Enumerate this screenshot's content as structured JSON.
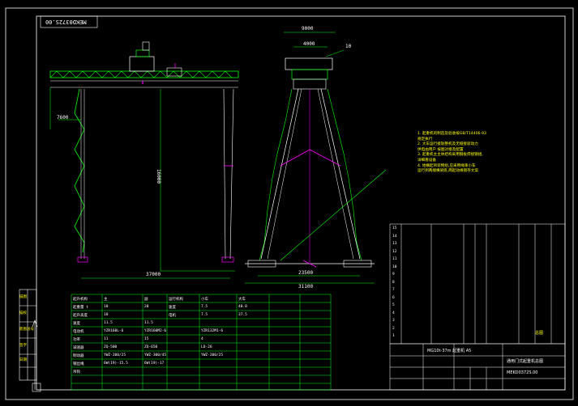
{
  "drawing": {
    "stamp_text": "MEKD0372S.00",
    "dimensions": {
      "top_width": "9000",
      "top_inner": "4000",
      "part_ref": "10",
      "left_overhang": "7600",
      "height": "16000",
      "span": "37000",
      "base_inner": "23500",
      "base_outer": "31100"
    },
    "notes": [
      "1. 起重机的制造及验收按GB/T14406-93",
      "   规定执行",
      "2. 大车运行接轨整机及无缝接驳动力",
      "   供电由用户 按图对接及配置",
      "3. 起重机主主体结构采用钢板焊接钢组,",
      "   详细看设备",
      "4. 地横起吊装物组,应采用绳束小车",
      "   运行到两端横梁底,两起动缘锁存文案"
    ],
    "left_sidebar": [
      "描图",
      "描校",
      "底图总号",
      "签字",
      "日期"
    ],
    "bom_rows": [
      "15",
      "14",
      "13",
      "12",
      "11",
      "10",
      "9",
      "8",
      "7",
      "6",
      "5",
      "4",
      "3",
      "2",
      "1"
    ],
    "title_block": {
      "model": "MG10t-37m 起重机 A5",
      "drawing_no": "MEKD0372S.00",
      "name": "通用门式起重机总图",
      "header_stamp": "总图"
    },
    "param_table": {
      "header": [
        "起升机构",
        "主",
        "副",
        "运行机构",
        "小车",
        "大车"
      ],
      "rows": [
        [
          "起重量 t",
          "10",
          "20",
          "速度",
          "7.5",
          "40.8"
        ],
        [
          "起升高度",
          "10",
          "",
          "电机",
          "7.5",
          "37.5"
        ],
        [
          "速度",
          "11.5",
          "11.5",
          "",
          "",
          ""
        ],
        [
          "电动机",
          "YZR160L-6",
          "YZR160M2-6",
          "",
          "YZR132M1-6",
          ""
        ],
        [
          "功率",
          "11",
          "15",
          "",
          "4",
          ""
        ],
        [
          "减速器",
          "ZQ-500",
          "ZQ-650",
          "",
          "LD-26",
          ""
        ],
        [
          "制动器",
          "YWZ-200/25",
          "YWZ-300/45",
          "",
          "YWZ-200/25",
          ""
        ],
        [
          "钢丝绳",
          "6W(19)-15.5",
          "6W(19)-17",
          "",
          "",
          ""
        ],
        [
          "吊钩",
          "",
          "",
          "",
          "",
          ""
        ]
      ]
    }
  }
}
